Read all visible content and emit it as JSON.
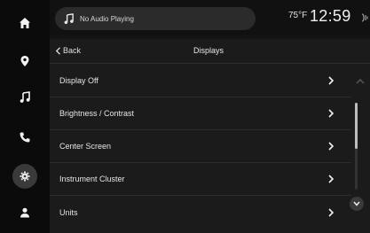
{
  "status_bar": {
    "media_text": "No Audio Playing",
    "temperature": "75°F",
    "time": "12:59"
  },
  "rail": {
    "items": [
      {
        "icon": "home-icon"
      },
      {
        "icon": "location-pin-icon"
      },
      {
        "icon": "music-note-icon"
      },
      {
        "icon": "phone-icon"
      },
      {
        "icon": "gear-icon",
        "active": true
      },
      {
        "icon": "person-icon"
      }
    ]
  },
  "header": {
    "back_label": "Back",
    "title": "Displays"
  },
  "list": {
    "items": [
      {
        "label": "Display Off"
      },
      {
        "label": "Brightness / Contrast"
      },
      {
        "label": "Center Screen"
      },
      {
        "label": "Instrument Cluster"
      },
      {
        "label": "Units"
      }
    ]
  },
  "colors": {
    "background": "#141414",
    "panel": "#1b1b1b",
    "text": "#e6e6e6",
    "active_rail": "#3a3a3a"
  }
}
